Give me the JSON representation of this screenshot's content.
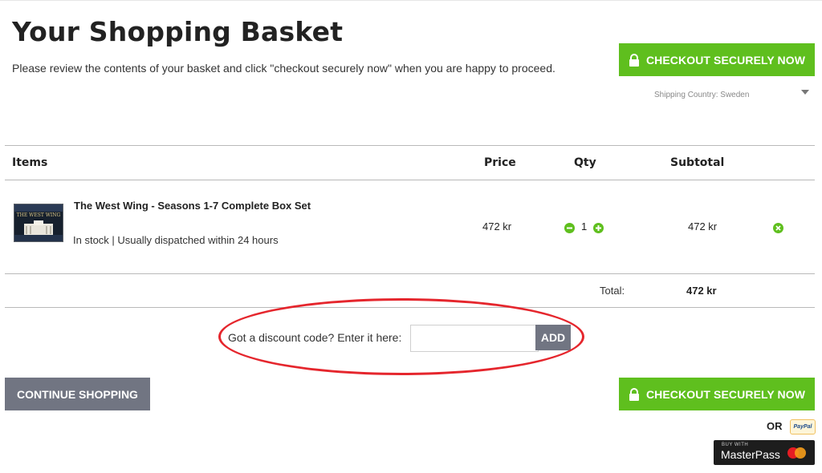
{
  "page": {
    "title": "Your Shopping Basket",
    "subtitle": "Please review the contents of your basket and click \"checkout securely now\" when you are happy to proceed."
  },
  "checkout": {
    "label": "CHECKOUT SECURELY NOW",
    "icon": "lock-icon",
    "color": "#5fbf1e"
  },
  "shipping": {
    "label": "Shipping Country: Sweden"
  },
  "table": {
    "headers": {
      "items": "Items",
      "price": "Price",
      "qty": "Qty",
      "subtotal": "Subtotal"
    },
    "rows": [
      {
        "name": "The West Wing - Seasons 1-7 Complete Box Set",
        "stock": "In stock | Usually dispatched within 24 hours",
        "price": "472 kr",
        "qty": "1",
        "subtotal": "472 kr",
        "thumb_text": "THE WEST WING"
      }
    ],
    "total_label": "Total:",
    "total_value": "472 kr"
  },
  "discount": {
    "label": "Got a discount code? Enter it here:",
    "value": "",
    "button": "ADD",
    "highlight_color": "#e5262d"
  },
  "continue": {
    "label": "CONTINUE SHOPPING",
    "color": "#717582"
  },
  "alt_payment": {
    "or_label": "OR",
    "paypal_label": "PayPal",
    "masterpass_top": "BUY WITH",
    "masterpass_label": "MasterPass"
  }
}
